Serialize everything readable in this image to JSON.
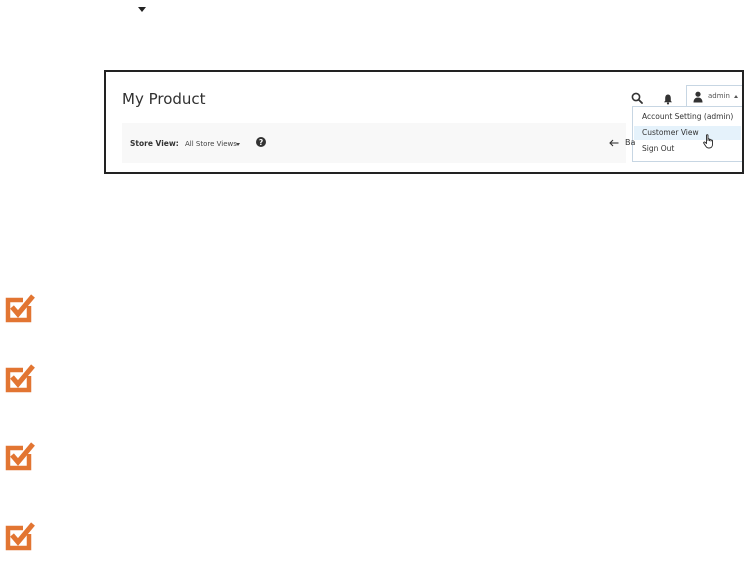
{
  "header": {
    "page_title": "My Product"
  },
  "account": {
    "username": "admin",
    "menu_items": [
      {
        "label": "Account Setting (admin)"
      },
      {
        "label": "Customer View",
        "hovered": true
      },
      {
        "label": "Sign Out"
      }
    ]
  },
  "store_bar": {
    "label": "Store View:",
    "selected": "All Store Views",
    "back_label": "Ba"
  },
  "icons": {
    "search": "search-icon",
    "notifications": "bell-icon",
    "user": "user-icon",
    "help": "help-icon",
    "cursor": "hand-cursor-icon",
    "checklist": "checkbox-checked-icon"
  },
  "colors": {
    "accent_orange": "#e27532",
    "hover_blue": "#e5f2fb",
    "dropdown_border": "#c7d6e3"
  }
}
